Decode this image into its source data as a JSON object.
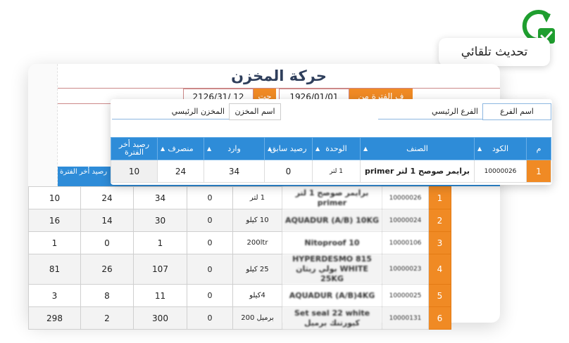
{
  "badge": {
    "label": "تحديث تلقائي",
    "icon": "refresh-check-icon",
    "icon_color": "#1f9e2f"
  },
  "page": {
    "title": "حركة المخزن",
    "from_label": "في الفترة من",
    "from_label_visible": "ف الفترة من",
    "from_date": "1926/01/01",
    "to_label": "حتى",
    "to_label_visible": "حت",
    "to_date": "2126/31/ 12",
    "accent_color": "#f08a24",
    "header_color": "#2e8cd8"
  },
  "popup": {
    "branch_label": "اسم الفرع",
    "branch_value": "الفرع الرئيسي",
    "store_label": "اسم المخزن",
    "store_value": "المخزن الرئيسي",
    "columns": [
      "م",
      "الكود",
      "الصنف",
      "الوحدة",
      "رصيد سابق",
      "وارد",
      "منصرف",
      "رصيد أخر الفترة"
    ],
    "row": {
      "index": "1",
      "code": "10000026",
      "item": "برايمر صوصح 1 لتر primer",
      "unit": "1 لتر",
      "previous": "0",
      "incoming": "34",
      "outgoing": "24",
      "balance": "10"
    }
  },
  "back_table": {
    "partial_header": "رصيد أخر الفترة",
    "rows": [
      {
        "index": "1",
        "code": "10000026",
        "item": "برايمر صوصح 1 لتر primer",
        "unit": "1 لتر",
        "previous": "0",
        "incoming": "34",
        "outgoing": "24",
        "balance": "10"
      },
      {
        "index": "2",
        "code": "10000024",
        "item": "AQUADUR (A/B) 10KG",
        "unit": "10 كيلو",
        "previous": "0",
        "incoming": "30",
        "outgoing": "14",
        "balance": "16"
      },
      {
        "index": "3",
        "code": "10000106",
        "item": "Nitoproof 10",
        "unit": "200ltr",
        "previous": "0",
        "incoming": "1",
        "outgoing": "0",
        "balance": "1"
      },
      {
        "index": "4",
        "code": "10000023",
        "item": "HYPERDESMO 815 WHITE بولي ريثان 25KG",
        "unit": "25 كيلو",
        "previous": "0",
        "incoming": "107",
        "outgoing": "26",
        "balance": "81"
      },
      {
        "index": "5",
        "code": "10000025",
        "item": "AQUADUR (A/B)4KG",
        "unit": "4كيلو",
        "previous": "0",
        "incoming": "11",
        "outgoing": "8",
        "balance": "3"
      },
      {
        "index": "6",
        "code": "10000131",
        "item": "Set seal 22 white كيورتنك برميل",
        "unit": "برميل 200",
        "previous": "0",
        "incoming": "300",
        "outgoing": "2",
        "balance": "298"
      }
    ]
  }
}
